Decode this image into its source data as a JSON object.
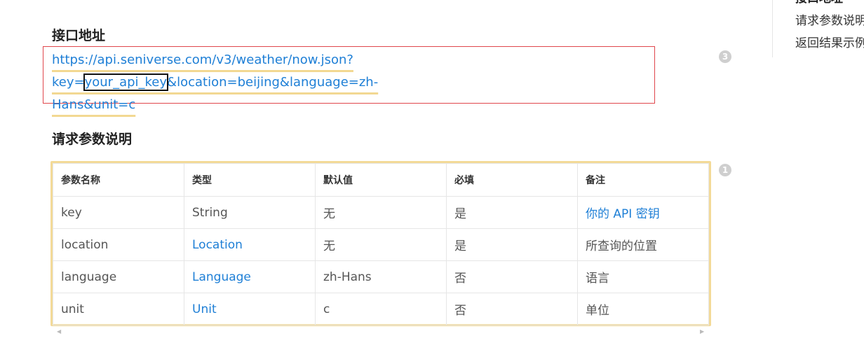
{
  "sections": {
    "api_address": {
      "heading": "接口地址",
      "url_line1_prefix": "https://api.seniverse.com/v3/weather/now.json?key=",
      "url_key": "your_api_key",
      "url_line1_suffix": "&location=beijing&language=zh-",
      "url_line2": "Hans&unit=c",
      "badge": "3"
    },
    "params": {
      "heading": "请求参数说明",
      "badge": "1",
      "columns": [
        "参数名称",
        "类型",
        "默认值",
        "必填",
        "备注"
      ],
      "rows": [
        [
          "key",
          "String",
          "无",
          "是",
          "你的 API 密钥"
        ],
        [
          "location",
          "Location",
          "无",
          "是",
          "所查询的位置"
        ],
        [
          "language",
          "Language",
          "zh-Hans",
          "否",
          "语言"
        ],
        [
          "unit",
          "Unit",
          "c",
          "否",
          "单位"
        ]
      ]
    }
  },
  "toc": {
    "items": [
      "接口地址",
      "请求参数说明",
      "返回结果示例"
    ],
    "active_index": 0
  },
  "icons": {
    "scroll_left": "scroll-left-arrow-icon",
    "scroll_right": "scroll-right-arrow-icon"
  },
  "colors": {
    "link": "#1e7fd6",
    "url_box_border": "#e0464c",
    "table_border_highlight": "#f3da98",
    "toc_active": "#2ea65f"
  }
}
